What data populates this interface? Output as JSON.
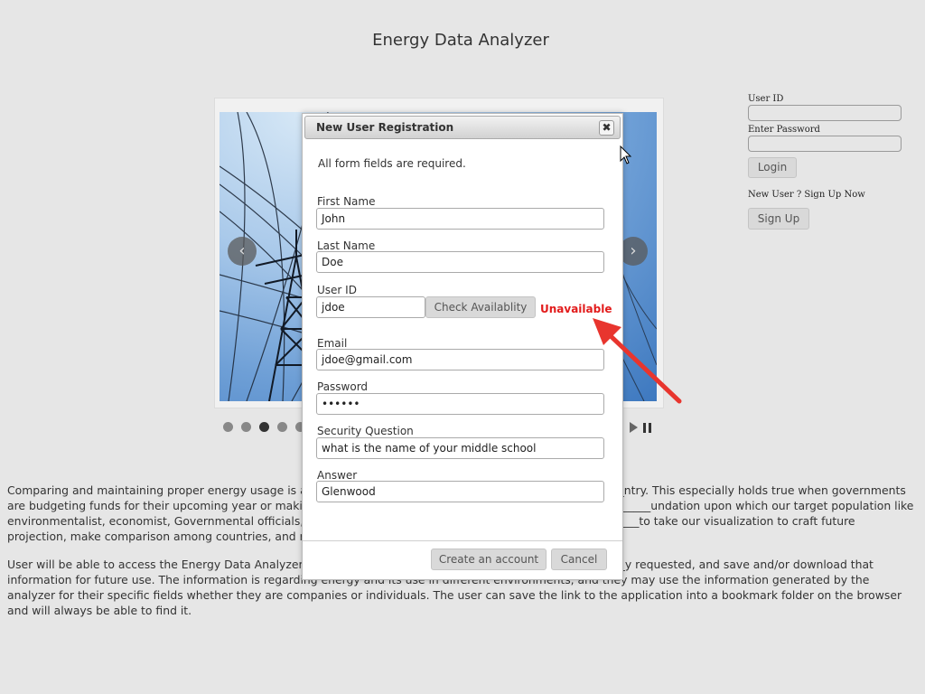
{
  "page": {
    "title": "Energy Data Analyzer"
  },
  "login": {
    "user_id_label": "User ID",
    "password_label": "Enter Password",
    "login_button": "Login",
    "new_user_text": "New User ? Sign Up Now",
    "signup_button": "Sign Up"
  },
  "carousel": {
    "prev_icon": "‹",
    "next_icon": "›",
    "active_dot": 3,
    "dot_count": 5
  },
  "paragraphs": {
    "p1": "Comparing and maintaining proper energy usage is an imp___________________________________________________ntry. This especially holds true when governments are budgeting funds for their upcoming year or making future_____________________________________________________undation upon which our target population like environmentalist, economist, Governmental officials, rese_______________________________________________________to take our visualization to craft future projection, make comparison among countries, and reduce, as much as pos",
    "p2": "User will be able to access the Energy Data Analyzer appli____________________________________________________y requested, and save and/or download that information for future use. The information is regarding energy and its use in different environments, and they may use the information generated by the analyzer for their specific fields whether they are companies or individuals. The user can save the link to the application into a bookmark folder on the browser and will always be able to find it."
  },
  "modal": {
    "title": "New User Registration",
    "close_icon": "✖",
    "required_note": "All form fields are required.",
    "first_name": {
      "label": "First Name",
      "value": "John"
    },
    "last_name": {
      "label": "Last Name",
      "value": "Doe"
    },
    "user_id": {
      "label": "User ID",
      "value": "jdoe",
      "check_button": "Check Availablity",
      "status": "Unavailable"
    },
    "email": {
      "label": "Email",
      "value": "jdoe@gmail.com"
    },
    "password": {
      "label": "Password",
      "value": "••••••"
    },
    "security_question": {
      "label": "Security Question",
      "value": "what is the name of your middle school"
    },
    "answer": {
      "label": "Answer",
      "value": "Glenwood"
    },
    "create_button": "Create an account",
    "cancel_button": "Cancel"
  },
  "colors": {
    "background": "#e6e6e6",
    "status_error": "#e21b1b",
    "annotation_arrow": "#e8352e"
  }
}
